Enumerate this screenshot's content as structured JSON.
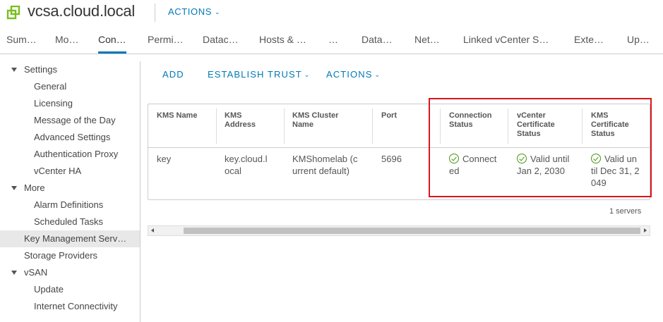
{
  "header": {
    "title": "vcsa.cloud.local",
    "actions_label": "ACTIONS",
    "logo_icon": "vcenter-logo-icon"
  },
  "tabs": [
    {
      "label": "Sum…"
    },
    {
      "label": "Mo…"
    },
    {
      "label": "Con…",
      "active": true
    },
    {
      "label": "Permi…"
    },
    {
      "label": "Datac…"
    },
    {
      "label": "Hosts & …"
    },
    {
      "label": "…"
    },
    {
      "label": "Data…"
    },
    {
      "label": "Net…"
    },
    {
      "label": "Linked vCenter S…"
    },
    {
      "label": "Exte…"
    },
    {
      "label": "Up…"
    }
  ],
  "sidebar": {
    "items": [
      {
        "label": "Settings",
        "type": "group"
      },
      {
        "label": "General"
      },
      {
        "label": "Licensing"
      },
      {
        "label": "Message of the Day"
      },
      {
        "label": "Advanced Settings"
      },
      {
        "label": "Authentication Proxy"
      },
      {
        "label": "vCenter HA"
      },
      {
        "label": "More",
        "type": "group"
      },
      {
        "label": "Alarm Definitions"
      },
      {
        "label": "Scheduled Tasks"
      },
      {
        "label": "Key Management Serv…",
        "selected": true
      },
      {
        "label": "Storage Providers"
      },
      {
        "label": "vSAN",
        "type": "group"
      },
      {
        "label": "Update"
      },
      {
        "label": "Internet Connectivity"
      }
    ]
  },
  "toolbar": {
    "add_label": "ADD",
    "establish_trust_label": "ESTABLISH TRUST",
    "actions_label": "ACTIONS"
  },
  "grid": {
    "columns": [
      {
        "line1": "KMS Name",
        "line2": "",
        "line3": ""
      },
      {
        "line1": "KMS",
        "line2": "Address",
        "line3": ""
      },
      {
        "line1": "KMS Cluster",
        "line2": "Name",
        "line3": ""
      },
      {
        "line1": "Port",
        "line2": "",
        "line3": ""
      },
      {
        "line1": "Connection",
        "line2": "Status",
        "line3": ""
      },
      {
        "line1": "vCenter",
        "line2": "Certificate",
        "line3": "Status"
      },
      {
        "line1": "KMS",
        "line2": "Certificate",
        "line3": "Status"
      }
    ],
    "rows": [
      {
        "kms_name": "key",
        "kms_address": [
          "key.cloud.l",
          "ocal"
        ],
        "kms_cluster": [
          "KMShomelab (c",
          "urrent default)"
        ],
        "port": "5696",
        "connection_status": [
          "Connect",
          "ed"
        ],
        "vcenter_cert": [
          "Valid until",
          "Jan 2, 2030"
        ],
        "kms_cert": [
          "Valid un",
          "til Dec 31, 2",
          "049"
        ]
      }
    ],
    "footer": "1 servers"
  },
  "colors": {
    "accent": "#0079b8",
    "success": "#48960c",
    "highlight": "#d9161c"
  }
}
